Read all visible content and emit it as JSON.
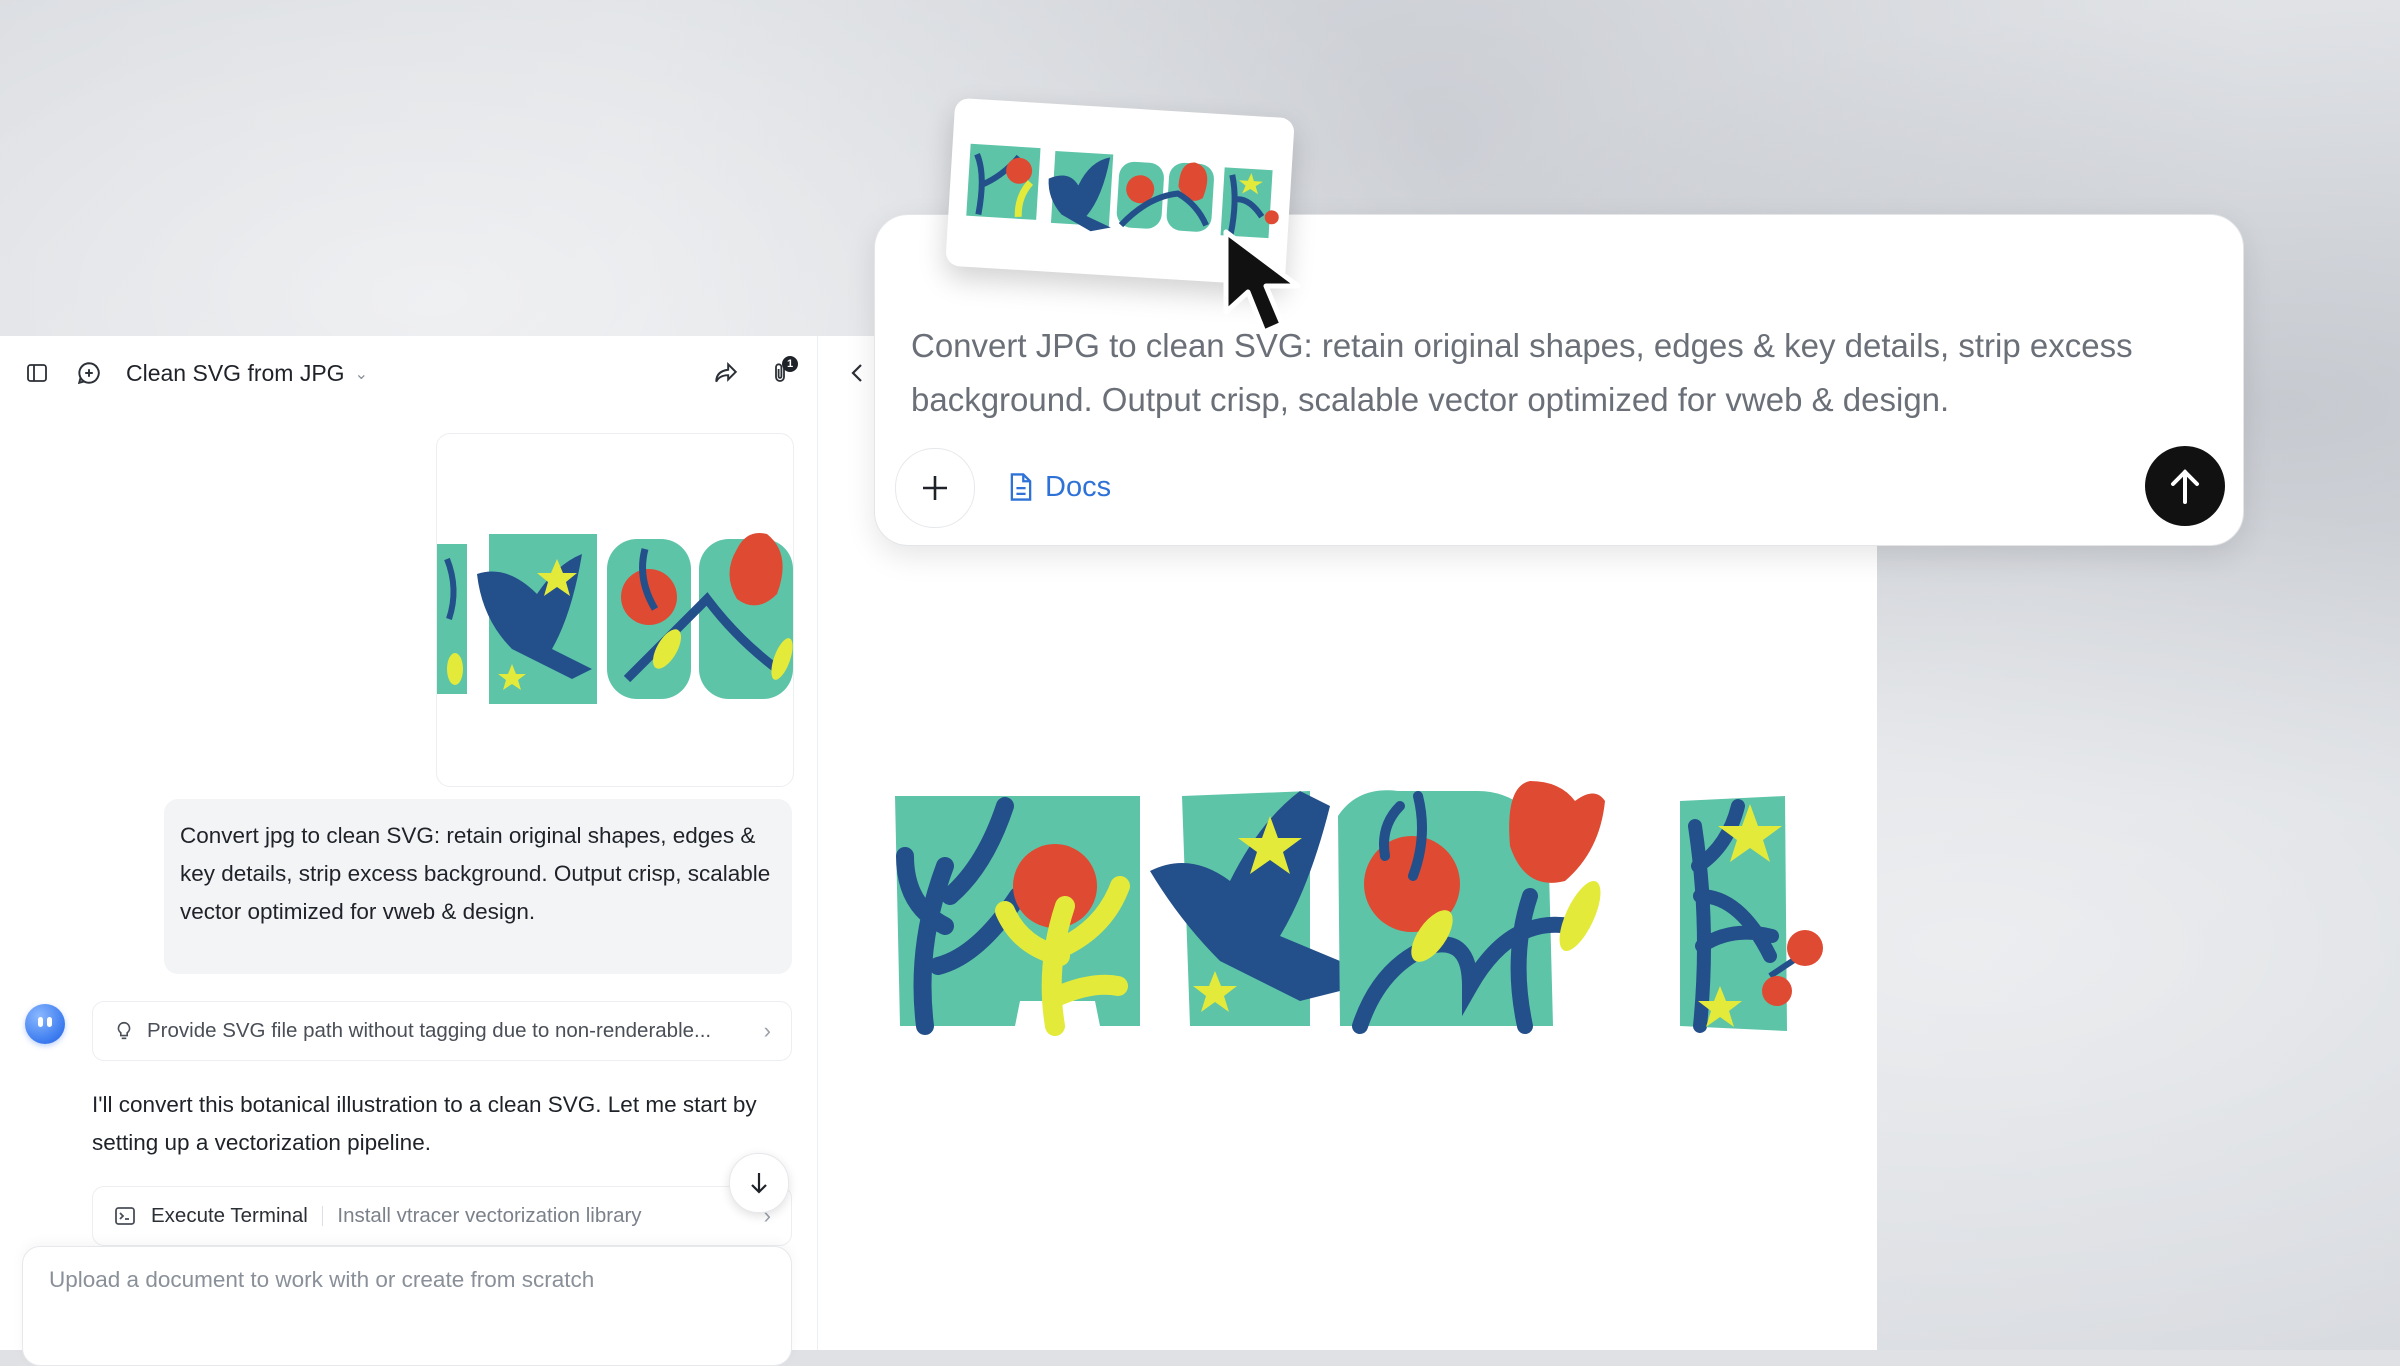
{
  "toolbar": {
    "sidebar_icon": "sidebar-toggle-icon",
    "new_chat_icon": "new-chat-icon",
    "title": "Clean SVG from JPG",
    "share_icon": "share-icon",
    "attachment_icon": "paperclip-icon",
    "attachment_count": "1"
  },
  "chat": {
    "user_image_alt": "botanical illustration",
    "user_message": "Convert jpg to clean SVG: retain original shapes, edges & key details, strip excess background. Output crisp, scalable vector optimized for vweb & design.",
    "hint": "Provide SVG file path without tagging due to non-renderable...",
    "bot_message": "I'll convert this botanical illustration to a clean SVG. Let me start by setting up a vectorization pipeline.",
    "exec_label": "Execute Terminal",
    "exec_desc": "Install vtracer vectorization library",
    "input_placeholder": "Upload a document to work with or create from scratch"
  },
  "prompt_card": {
    "text": "Convert JPG to clean SVG: retain original shapes, edges & key details, strip excess background. Output crisp, scalable vector optimized for vweb & design.",
    "docs_label": "Docs",
    "plus_icon": "plus-icon",
    "send_icon": "arrow-up-icon"
  },
  "colors": {
    "teal": "#5dc4a8",
    "navy": "#234f8a",
    "red": "#df4a32",
    "yellow": "#e4ea3a",
    "accent_blue": "#2e72d8"
  }
}
